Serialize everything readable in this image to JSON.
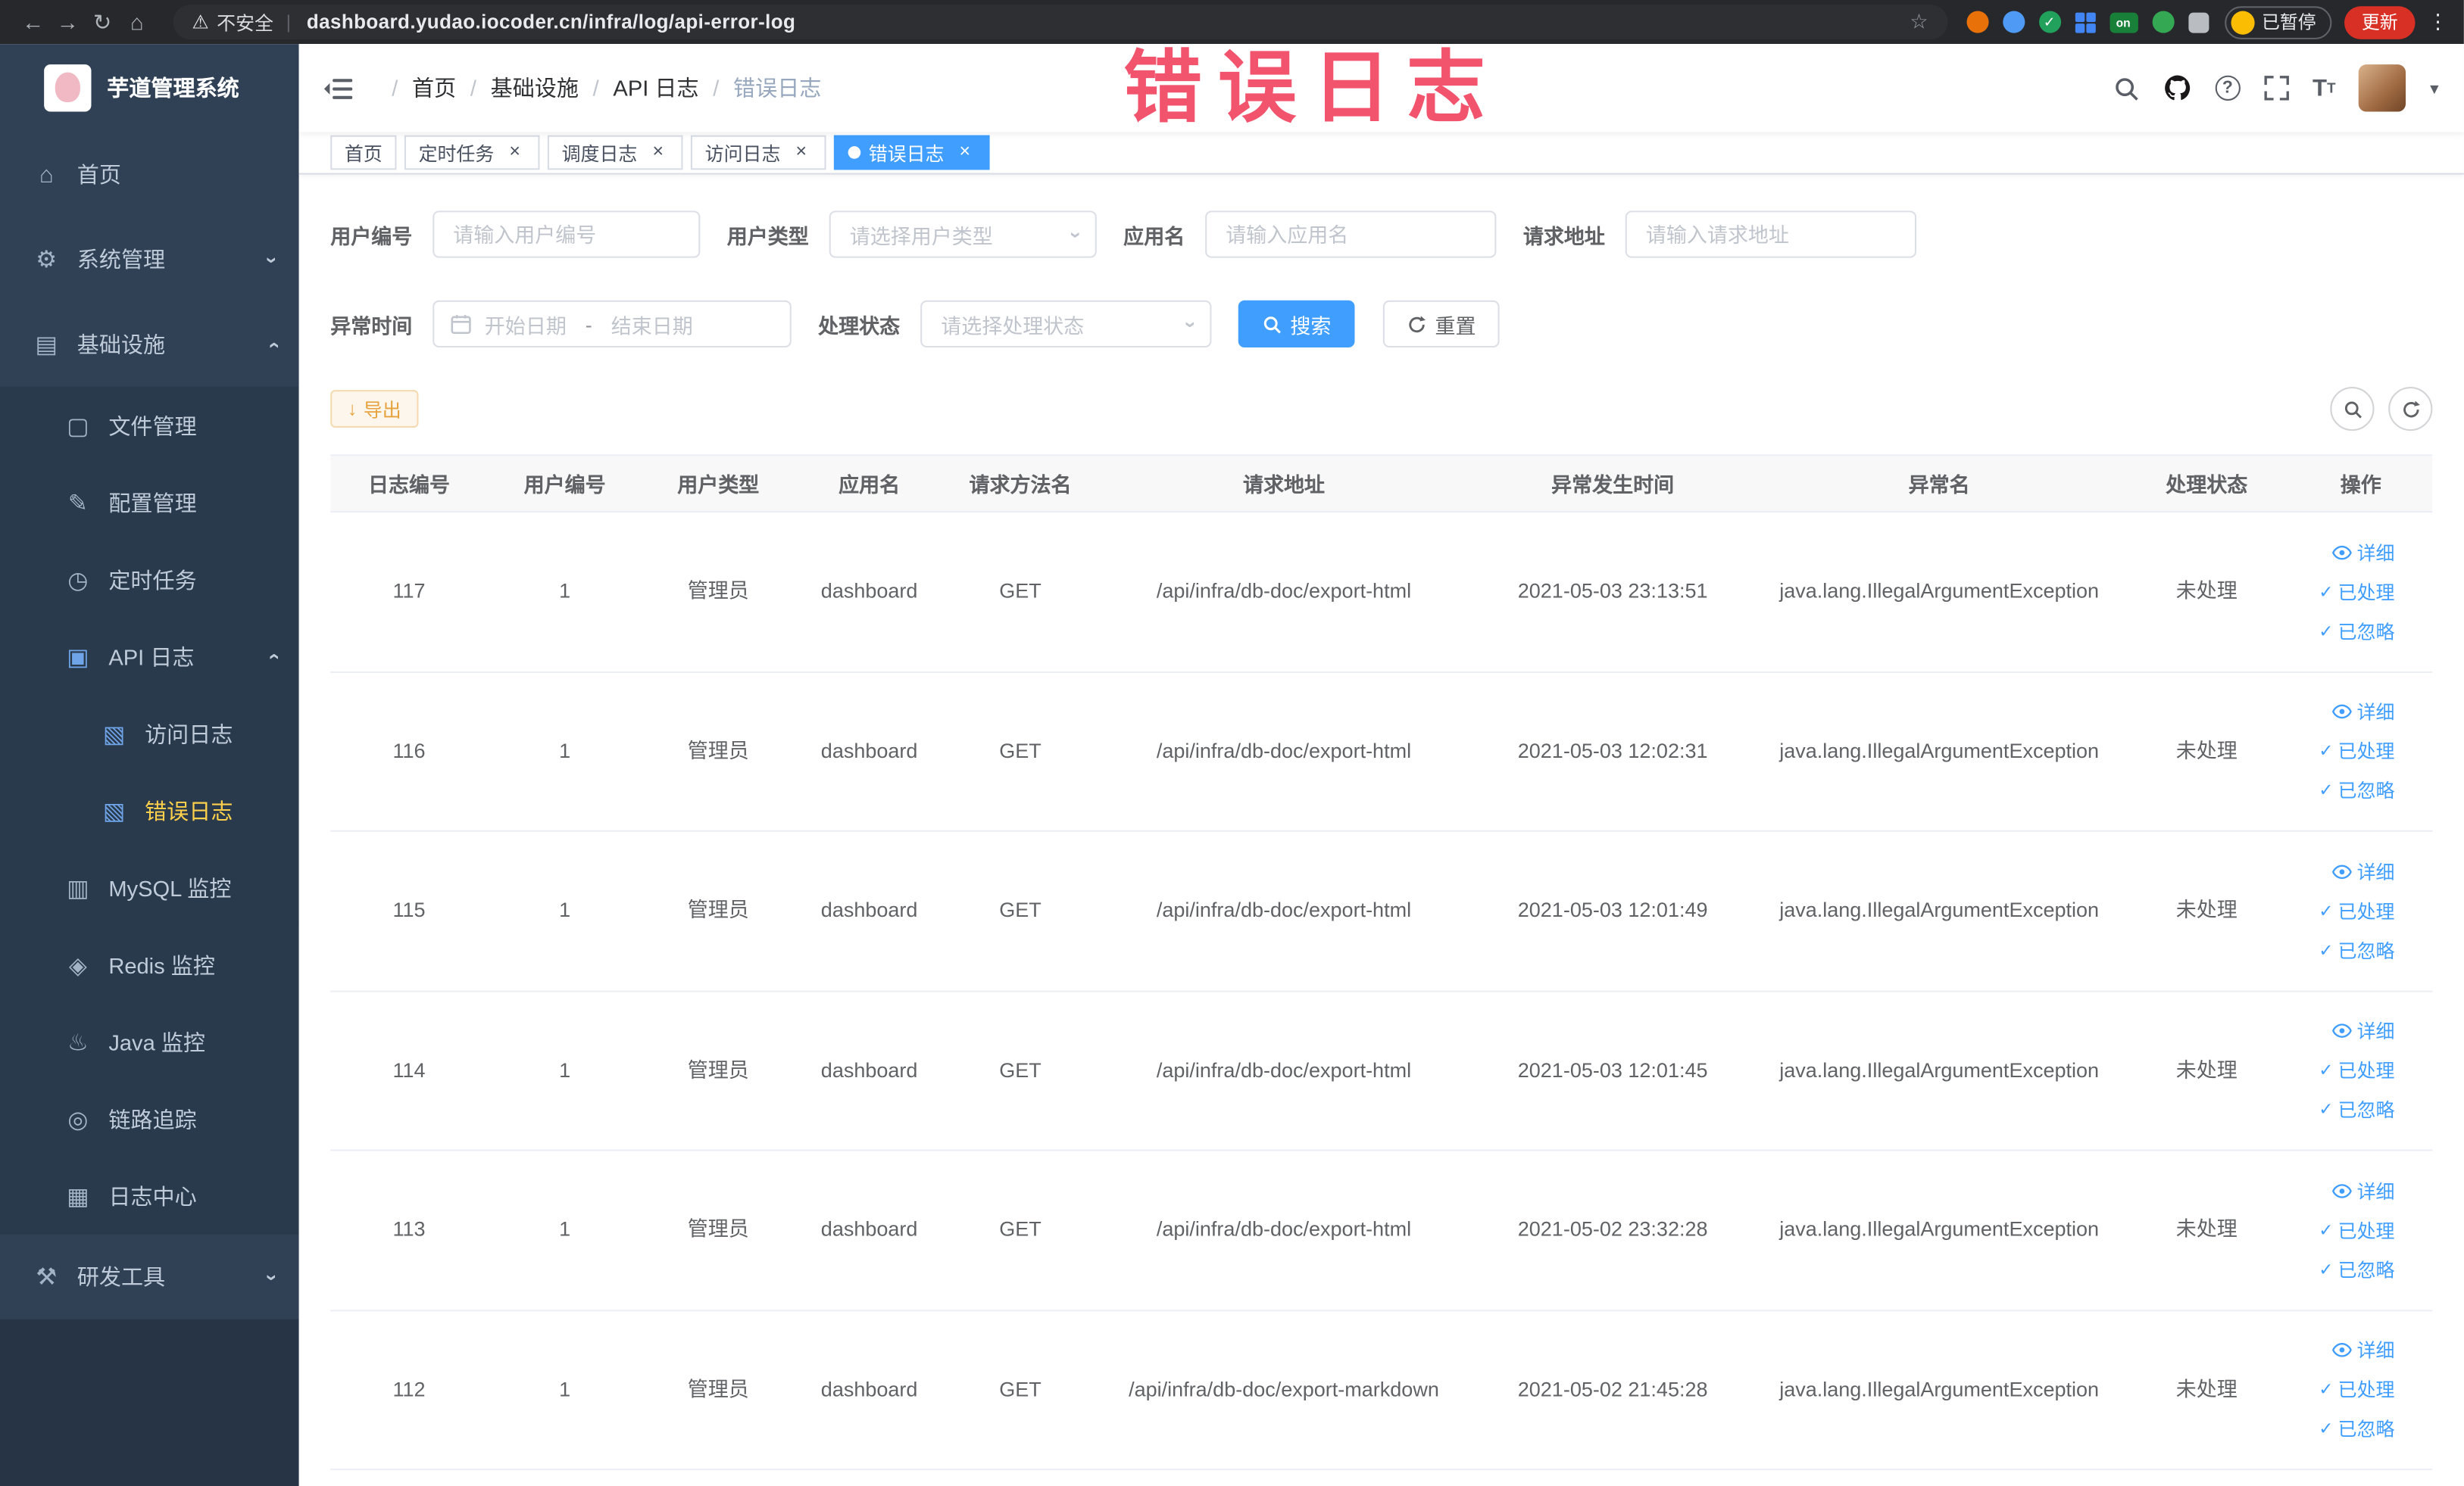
{
  "browser": {
    "security_label": "不安全",
    "url": "dashboard.yudao.iocoder.cn/infra/log/api-error-log",
    "profile_chip_label": "已暂停",
    "update_button_label": "更新",
    "extension_badge": "on"
  },
  "watermark": "错误日志",
  "sidebar": {
    "logo_title": "芋道管理系统",
    "items": [
      {
        "label": "首页",
        "icon": "home-icon",
        "level": 1
      },
      {
        "label": "系统管理",
        "icon": "gear-icon",
        "level": 1,
        "expand": "down"
      },
      {
        "label": "基础设施",
        "icon": "infra-icon",
        "level": 1,
        "expand": "up"
      },
      {
        "label": "文件管理",
        "icon": "file-icon",
        "level": 2
      },
      {
        "label": "配置管理",
        "icon": "config-icon",
        "level": 2
      },
      {
        "label": "定时任务",
        "icon": "timer-icon",
        "level": 2
      },
      {
        "label": "API 日志",
        "icon": "api-log-icon",
        "level": 2,
        "expand": "up"
      },
      {
        "label": "访问日志",
        "icon": "doc-icon",
        "level": 3
      },
      {
        "label": "错误日志",
        "icon": "doc-icon",
        "level": 3,
        "active": true
      },
      {
        "label": "MySQL 监控",
        "icon": "mysql-icon",
        "level": 2
      },
      {
        "label": "Redis 监控",
        "icon": "redis-icon",
        "level": 2
      },
      {
        "label": "Java 监控",
        "icon": "java-icon",
        "level": 2
      },
      {
        "label": "链路追踪",
        "icon": "trace-icon",
        "level": 2
      },
      {
        "label": "日志中心",
        "icon": "log-center-icon",
        "level": 2
      },
      {
        "label": "研发工具",
        "icon": "tools-icon",
        "level": 1,
        "expand": "down"
      }
    ]
  },
  "breadcrumb": [
    "首页",
    "基础设施",
    "API 日志",
    "错误日志"
  ],
  "tabs": [
    {
      "label": "首页"
    },
    {
      "label": "定时任务",
      "closable": true
    },
    {
      "label": "调度日志",
      "closable": true
    },
    {
      "label": "访问日志",
      "closable": true
    },
    {
      "label": "错误日志",
      "closable": true,
      "active": true
    }
  ],
  "filters": {
    "user_id_label": "用户编号",
    "user_id_placeholder": "请输入用户编号",
    "user_type_label": "用户类型",
    "user_type_placeholder": "请选择用户类型",
    "app_name_label": "应用名",
    "app_name_placeholder": "请输入应用名",
    "request_url_label": "请求地址",
    "request_url_placeholder": "请输入请求地址",
    "exception_time_label": "异常时间",
    "date_start_placeholder": "开始日期",
    "date_separator": "-",
    "date_end_placeholder": "结束日期",
    "process_status_label": "处理状态",
    "process_status_placeholder": "请选择处理状态",
    "search_label": "搜索",
    "reset_label": "重置"
  },
  "toolbar": {
    "export_label": "导出"
  },
  "table": {
    "columns": [
      "日志编号",
      "用户编号",
      "用户类型",
      "应用名",
      "请求方法名",
      "请求地址",
      "异常发生时间",
      "异常名",
      "处理状态",
      "操作"
    ],
    "actions": [
      "详细",
      "已处理",
      "已忽略"
    ],
    "rows": [
      {
        "id": "117",
        "user_id": "1",
        "user_type": "管理员",
        "app": "dashboard",
        "method": "GET",
        "url": "/api/infra/db-doc/export-html",
        "time": "2021-05-03 23:13:51",
        "exception": "java.lang.IllegalArgumentException",
        "status": "未处理"
      },
      {
        "id": "116",
        "user_id": "1",
        "user_type": "管理员",
        "app": "dashboard",
        "method": "GET",
        "url": "/api/infra/db-doc/export-html",
        "time": "2021-05-03 12:02:31",
        "exception": "java.lang.IllegalArgumentException",
        "status": "未处理"
      },
      {
        "id": "115",
        "user_id": "1",
        "user_type": "管理员",
        "app": "dashboard",
        "method": "GET",
        "url": "/api/infra/db-doc/export-html",
        "time": "2021-05-03 12:01:49",
        "exception": "java.lang.IllegalArgumentException",
        "status": "未处理"
      },
      {
        "id": "114",
        "user_id": "1",
        "user_type": "管理员",
        "app": "dashboard",
        "method": "GET",
        "url": "/api/infra/db-doc/export-html",
        "time": "2021-05-03 12:01:45",
        "exception": "java.lang.IllegalArgumentException",
        "status": "未处理"
      },
      {
        "id": "113",
        "user_id": "1",
        "user_type": "管理员",
        "app": "dashboard",
        "method": "GET",
        "url": "/api/infra/db-doc/export-html",
        "time": "2021-05-02 23:32:28",
        "exception": "java.lang.IllegalArgumentException",
        "status": "未处理"
      },
      {
        "id": "112",
        "user_id": "1",
        "user_type": "管理员",
        "app": "dashboard",
        "method": "GET",
        "url": "/api/infra/db-doc/export-markdown",
        "time": "2021-05-02 21:45:28",
        "exception": "java.lang.IllegalArgumentException",
        "status": "未处理"
      }
    ]
  },
  "colors": {
    "primary": "#409EFF",
    "warning": "#E6A23C",
    "sidebar_bg": "#304156",
    "menu_active_text": "#FFD04B",
    "watermark": "#F2536D",
    "chrome_bg": "#26282B"
  }
}
